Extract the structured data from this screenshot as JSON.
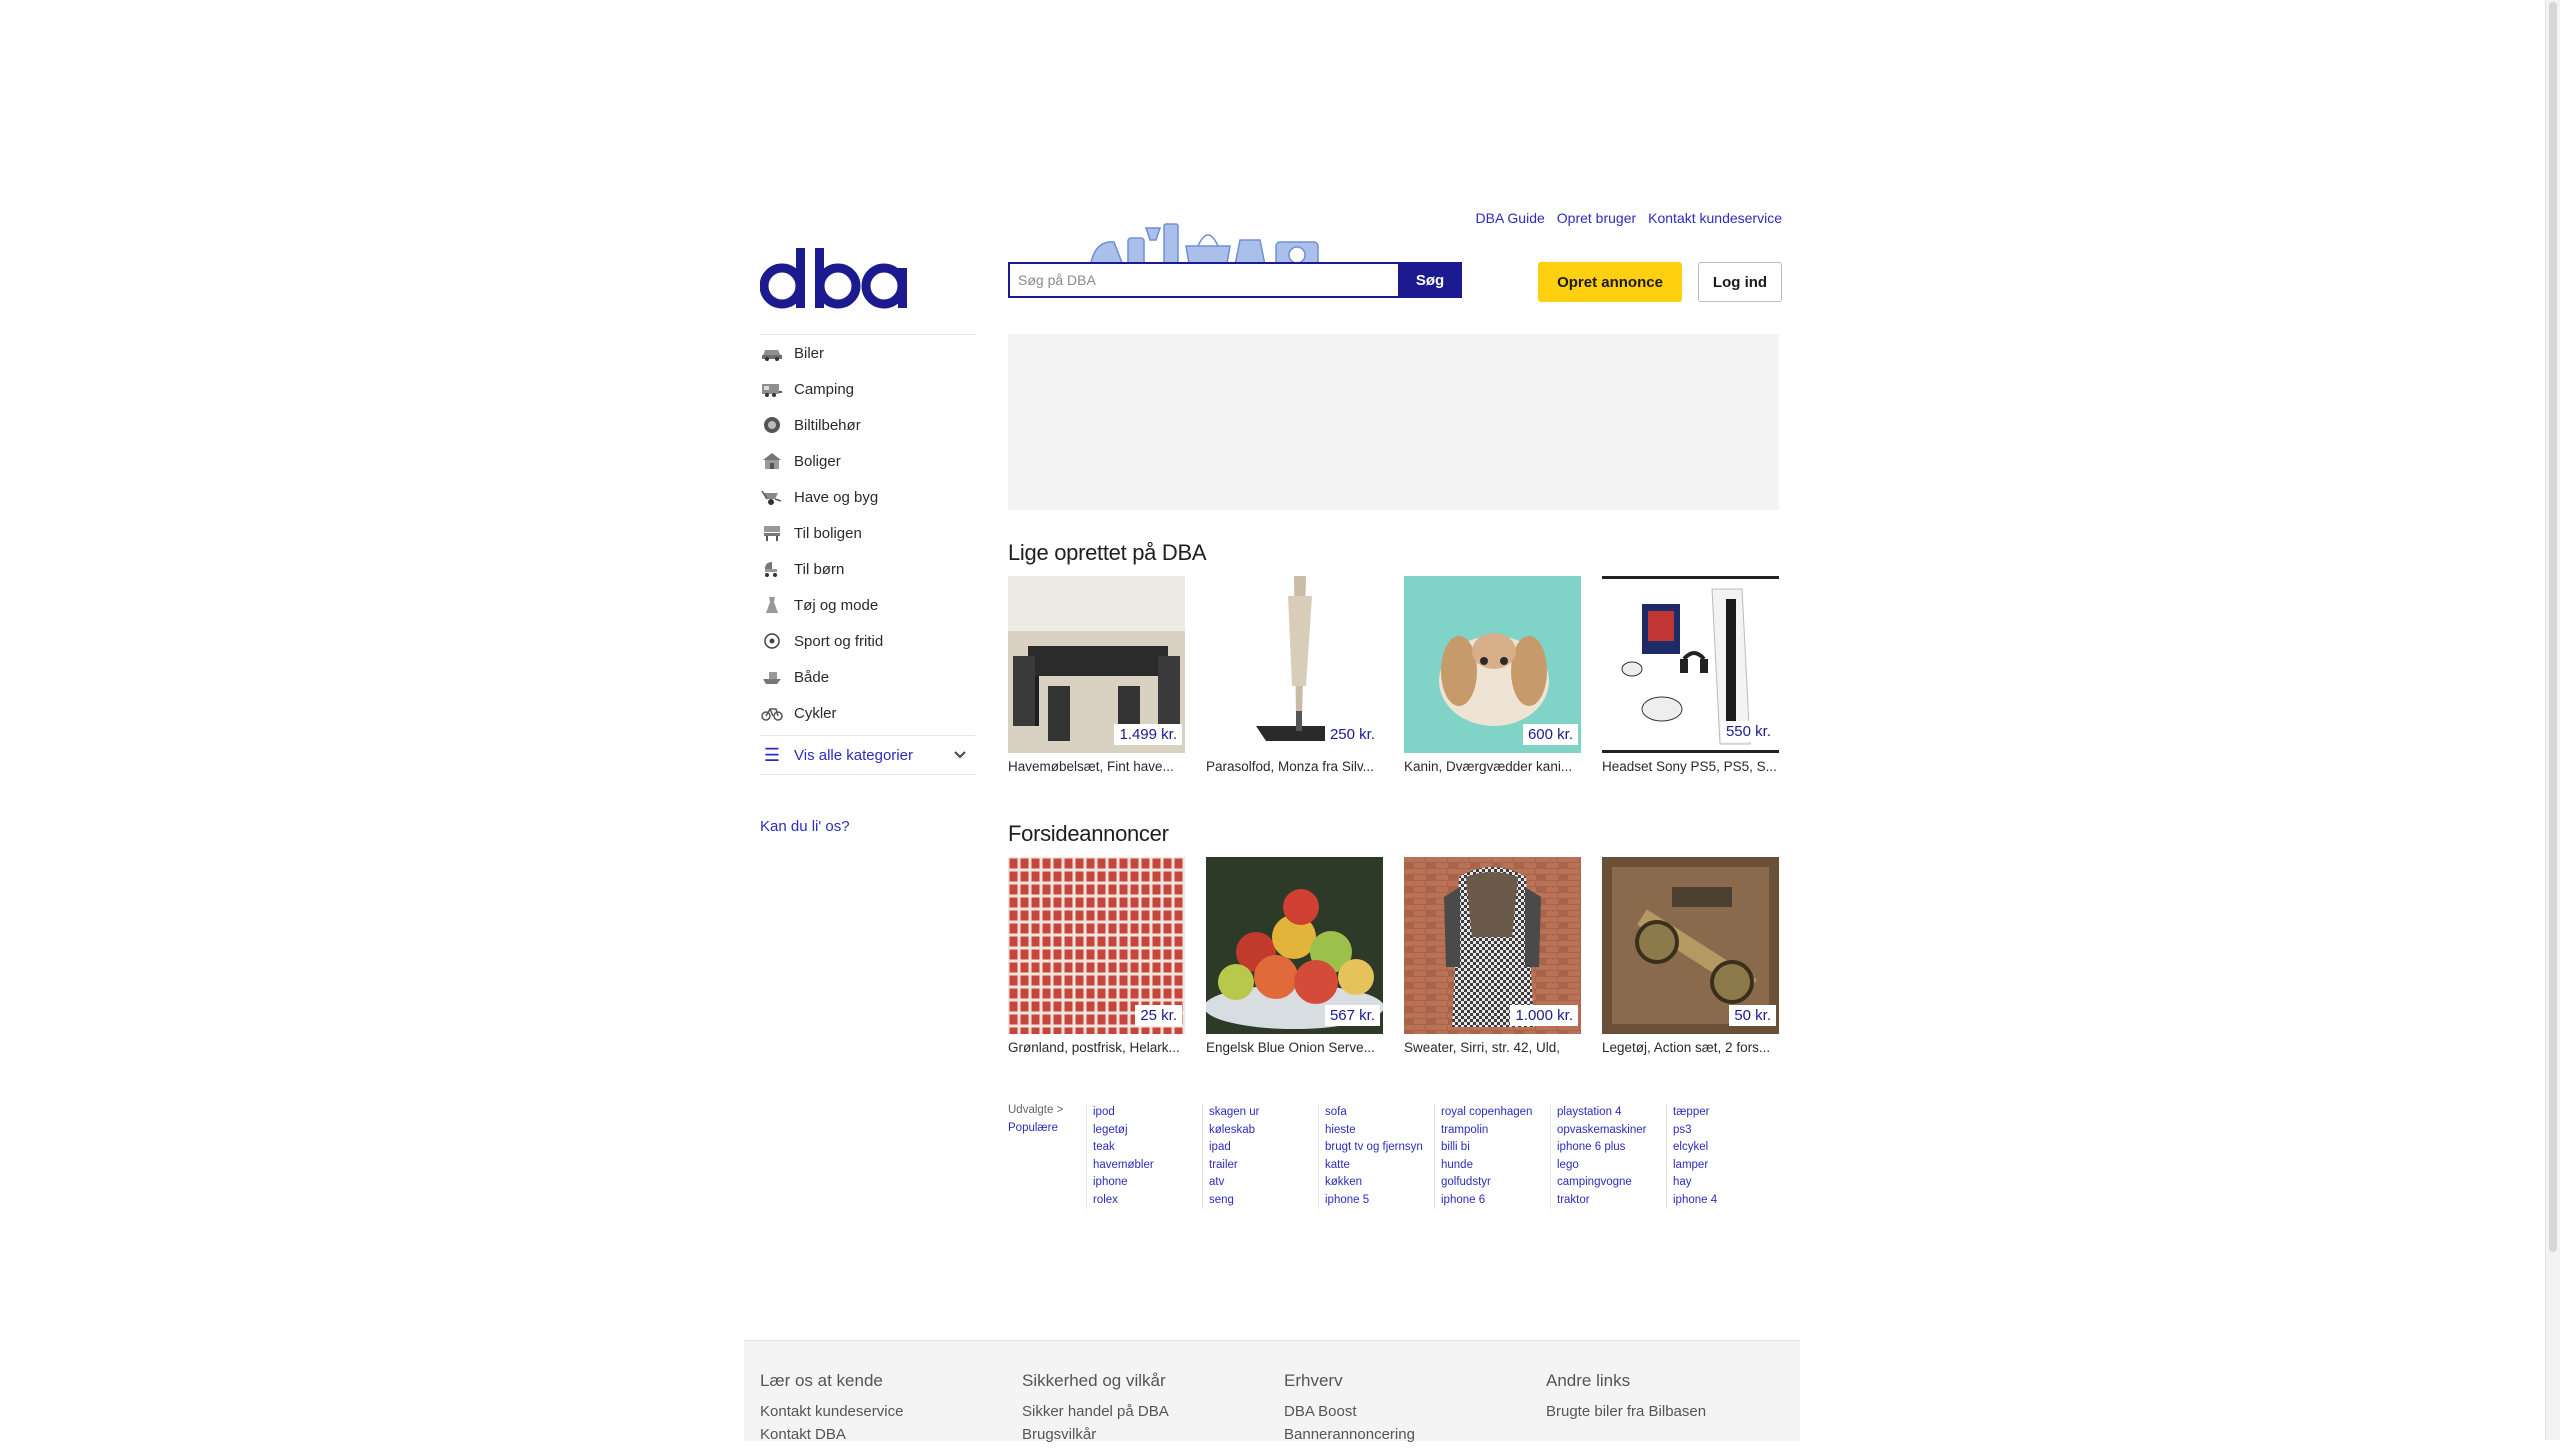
{
  "header": {
    "top_links": [
      "DBA Guide",
      "Opret bruger",
      "Kontakt kundeservice"
    ],
    "search_placeholder": "Søg på DBA",
    "search_button": "Søg",
    "create_button": "Opret annonce",
    "login_button": "Log ind",
    "logo_text": "dba"
  },
  "colors": {
    "brand": "#1b1b8f",
    "link": "#2c2cbf",
    "create_button": "#ffd00f"
  },
  "sidebar": {
    "categories": [
      {
        "label": "Biler",
        "icon": "car-icon"
      },
      {
        "label": "Camping",
        "icon": "camper-icon"
      },
      {
        "label": "Biltilbehør",
        "icon": "tire-icon"
      },
      {
        "label": "Boliger",
        "icon": "house-icon"
      },
      {
        "label": "Have og byg",
        "icon": "wheelbarrow-icon"
      },
      {
        "label": "Til boligen",
        "icon": "lamp-icon"
      },
      {
        "label": "Til børn",
        "icon": "stroller-icon"
      },
      {
        "label": "Tøj og mode",
        "icon": "dress-icon"
      },
      {
        "label": "Sport og fritid",
        "icon": "football-icon"
      },
      {
        "label": "Både",
        "icon": "boat-icon"
      },
      {
        "label": "Cykler",
        "icon": "bicycle-icon"
      }
    ],
    "show_all": "Vis alle kategorier",
    "kan_du": "Kan du li' os?"
  },
  "recent": {
    "title": "Lige oprettet på DBA",
    "items": [
      {
        "caption": "Havemøbelsæt, Fint have...",
        "price": "1.499 kr."
      },
      {
        "caption": "Parasolfod, Monza fra Silv...",
        "price": "250 kr."
      },
      {
        "caption": "Kanin, Dværgvædder kani...",
        "price": "600 kr."
      },
      {
        "caption": "Headset Sony PS5, PS5, S...",
        "price": "550 kr."
      }
    ]
  },
  "featured": {
    "title": "Forsideannoncer",
    "items": [
      {
        "caption": "Grønland, postfrisk, Helark...",
        "price": "25 kr."
      },
      {
        "caption": "Engelsk Blue Onion Serve...",
        "price": "567 kr."
      },
      {
        "caption": "Sweater, Sirri, str. 42, Uld,",
        "price": "1.000 kr."
      },
      {
        "caption": "Legetøj, Action sæt, 2 fors...",
        "price": "50 kr."
      }
    ]
  },
  "popular": {
    "tab_selected": "Udvalgte >",
    "tab_other": "Populære",
    "columns": [
      [
        "ipod",
        "legetøj",
        "teak",
        "havemøbler",
        "iphone",
        "rolex"
      ],
      [
        "skagen ur",
        "køleskab",
        "ipad",
        "trailer",
        "atv",
        "seng"
      ],
      [
        "sofa",
        "hieste",
        "brugt tv og fjernsyn",
        "katte",
        "køkken",
        "iphone 5"
      ],
      [
        "royal copenhagen",
        "trampolin",
        "billi bi",
        "hunde",
        "golfudstyr",
        "iphone 6"
      ],
      [
        "playstation 4",
        "opvaskemaskiner",
        "iphone 6 plus",
        "lego",
        "campingvogne",
        "traktor"
      ],
      [
        "tæpper",
        "ps3",
        "elcykel",
        "lamper",
        "hay",
        "iphone 4"
      ]
    ]
  },
  "footer": {
    "columns": [
      {
        "title": "Lær os at kende",
        "links": [
          "Kontakt kundeservice",
          "Kontakt DBA"
        ]
      },
      {
        "title": "Sikkerhed og vilkår",
        "links": [
          "Sikker handel på DBA",
          "Brugsvilkår"
        ]
      },
      {
        "title": "Erhverv",
        "links": [
          "DBA Boost",
          "Bannerannoncering"
        ]
      },
      {
        "title": "Andre links",
        "links": [
          "Brugte biler fra Bilbasen"
        ]
      }
    ]
  }
}
